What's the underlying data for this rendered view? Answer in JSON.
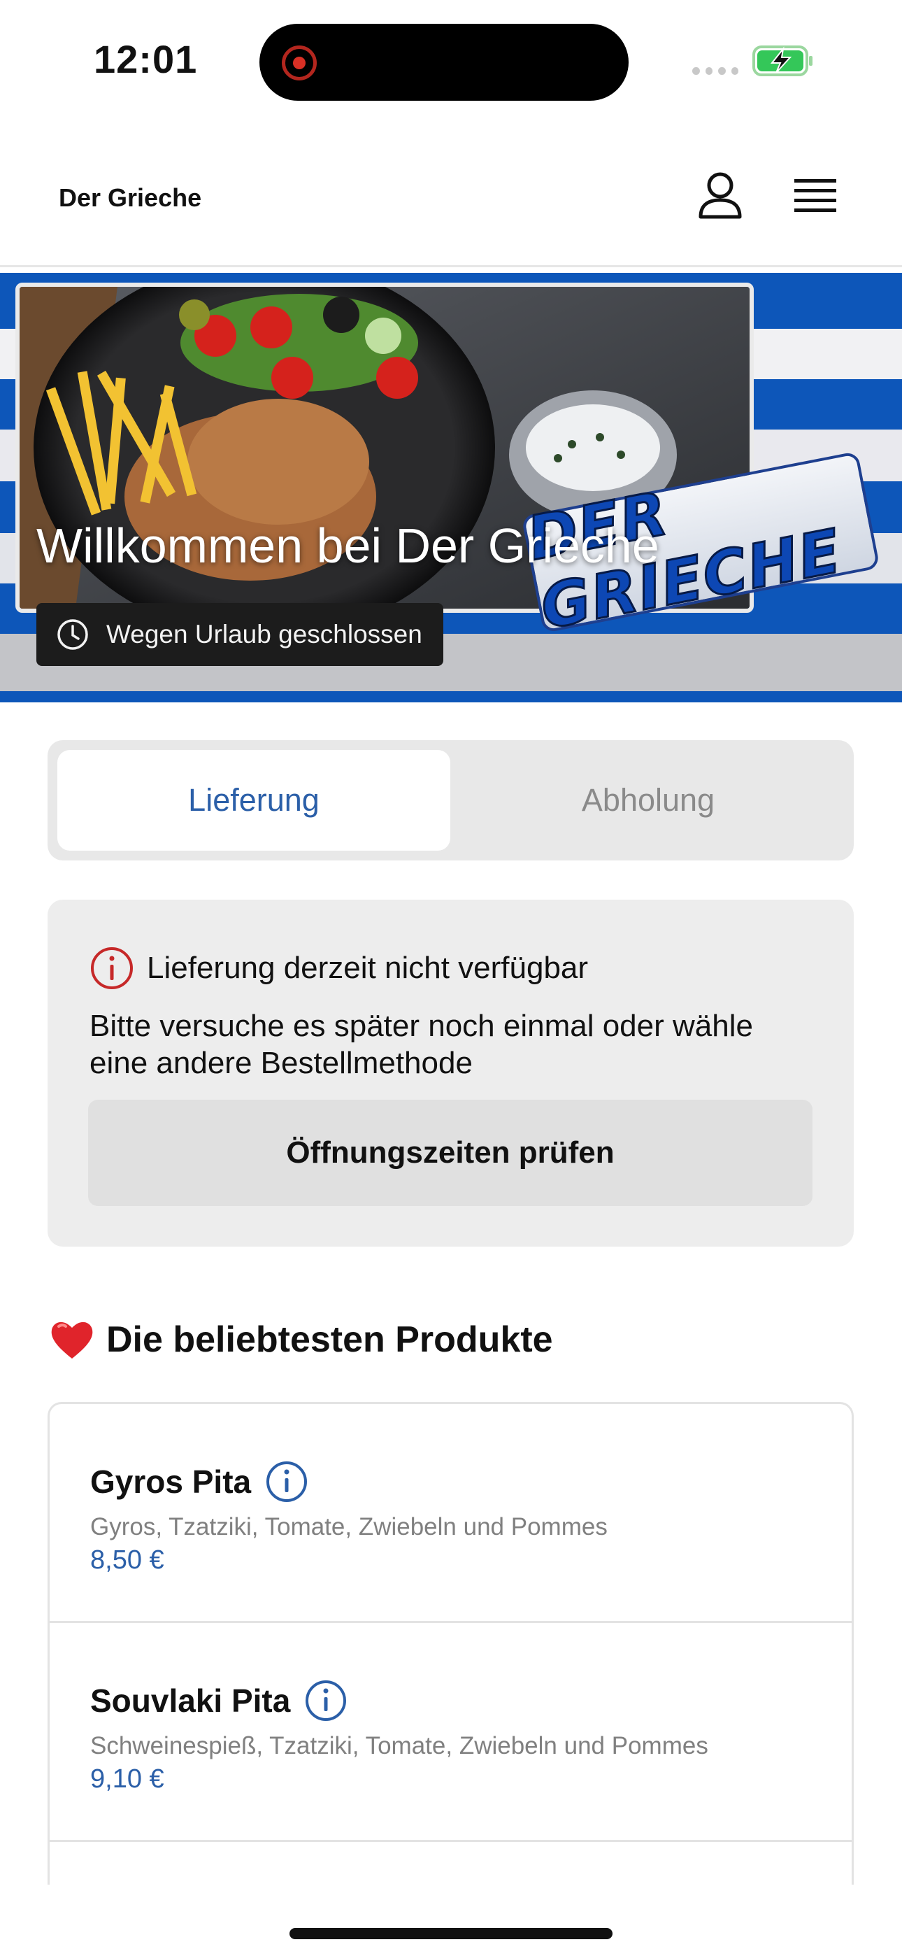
{
  "status_bar": {
    "time": "12:01",
    "icons": [
      "recording-icon",
      "signal-icon",
      "battery-charging-icon"
    ]
  },
  "header": {
    "brand": "Der Grieche",
    "icons": [
      "user-icon",
      "hamburger-menu-icon"
    ]
  },
  "hero": {
    "title": "Willkommen bei Der Grieche",
    "logo_text": "DER GRIECHE",
    "closed_badge": "Wegen Urlaub geschlossen",
    "badge_icon": "clock-icon"
  },
  "order_mode": {
    "tabs": [
      {
        "label": "Lieferung",
        "selected": true
      },
      {
        "label": "Abholung",
        "selected": false
      }
    ]
  },
  "notice": {
    "icon": "info-circle-icon",
    "title": "Lieferung derzeit nicht verfügbar",
    "body": "Bitte versuche es später noch einmal oder wähle eine andere Bestellmethode",
    "button": "Öffnungszeiten prüfen"
  },
  "popular": {
    "heading": "Die beliebtesten Produkte",
    "icon": "heart-icon",
    "products": [
      {
        "name": "Gyros Pita",
        "description": "Gyros, Tzatziki, Tomate, Zwiebeln und Pommes",
        "price": "8,50 €"
      },
      {
        "name": "Souvlaki Pita",
        "description": "Schweinespieß, Tzatziki, Tomate, Zwiebeln und Pommes",
        "price": "9,10 €"
      }
    ]
  },
  "colors": {
    "accent_blue": "#2b5fa8",
    "flag_blue": "#0d56b9",
    "alert_red": "#c62828"
  }
}
